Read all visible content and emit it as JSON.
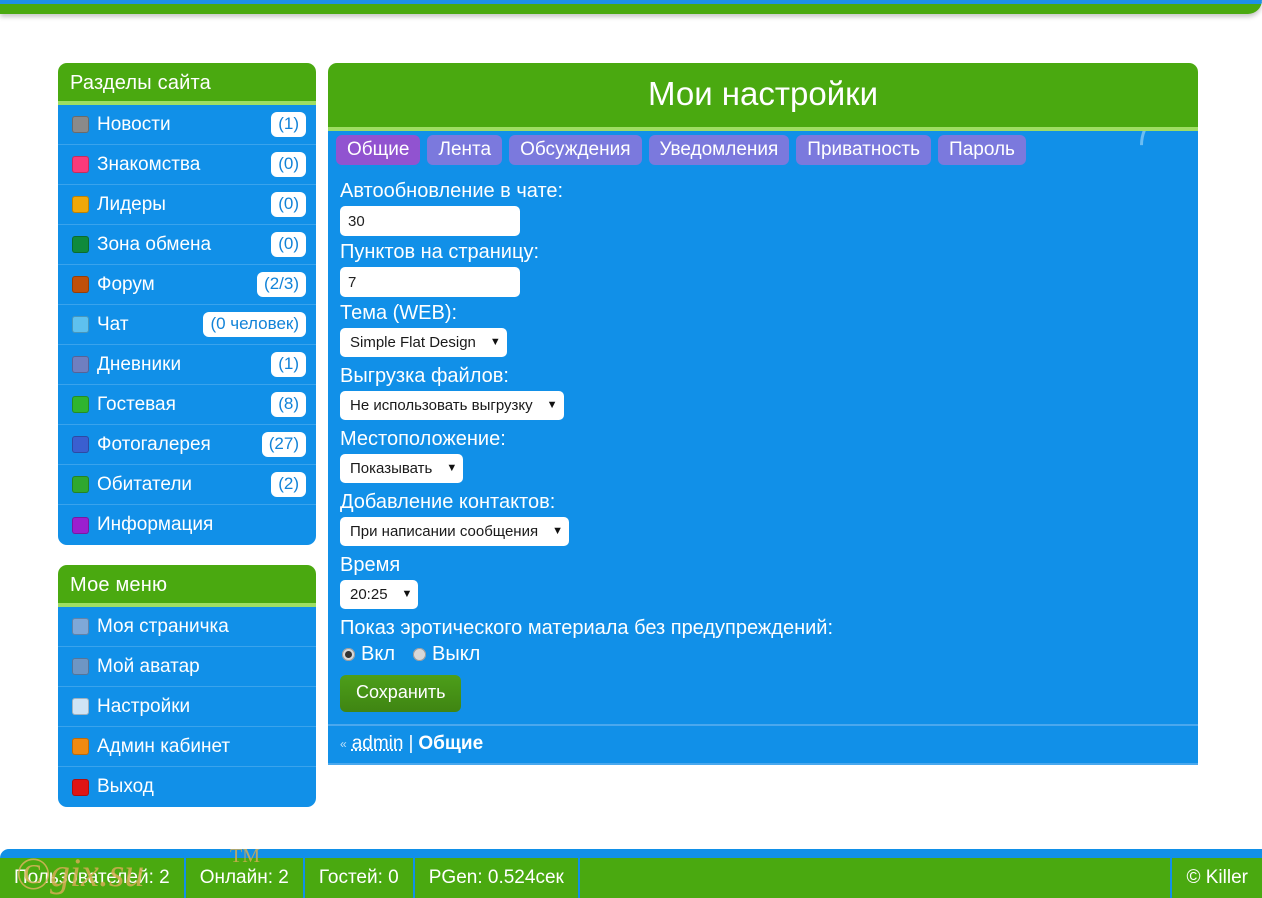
{
  "sidebar": {
    "sections": [
      {
        "title": "Разделы сайта",
        "items": [
          {
            "label": "Новости",
            "badge": "(1)",
            "icon": "news-icon",
            "color": "#8a8a8a"
          },
          {
            "label": "Знакомства",
            "badge": "(0)",
            "icon": "heart-icon",
            "color": "#fa3a7a"
          },
          {
            "label": "Лидеры",
            "badge": "(0)",
            "icon": "trophy-icon",
            "color": "#f0a808"
          },
          {
            "label": "Зона обмена",
            "badge": "(0)",
            "icon": "exchange-icon",
            "color": "#0f8a3c"
          },
          {
            "label": "Форум",
            "badge": "(2/3)",
            "icon": "forum-icon",
            "color": "#c0500a"
          },
          {
            "label": "Чат",
            "badge": "(0 человек)",
            "icon": "chat-icon",
            "color": "#5ec1ef"
          },
          {
            "label": "Дневники",
            "badge": "(1)",
            "icon": "diary-icon",
            "color": "#6f7fc0"
          },
          {
            "label": "Гостевая",
            "badge": "(8)",
            "icon": "guestbook-icon",
            "color": "#2fb52f"
          },
          {
            "label": "Фотогалерея",
            "badge": "(27)",
            "icon": "photo-icon",
            "color": "#3a5fd0"
          },
          {
            "label": "Обитатели",
            "badge": "(2)",
            "icon": "users-icon",
            "color": "#2fa82f"
          },
          {
            "label": "Информация",
            "badge": "",
            "icon": "info-icon",
            "color": "#9b1fcf"
          }
        ]
      },
      {
        "title": "Мое меню",
        "items": [
          {
            "label": "Моя страничка",
            "badge": "",
            "icon": "profile-card-icon",
            "color": "#7fa8d8"
          },
          {
            "label": "Мой аватар",
            "badge": "",
            "icon": "avatar-icon",
            "color": "#6e96c4"
          },
          {
            "label": "Настройки",
            "badge": "",
            "icon": "gear-icon",
            "color": "#cfe4f5"
          },
          {
            "label": "Админ кабинет",
            "badge": "",
            "icon": "admin-icon",
            "color": "#f08a10"
          },
          {
            "label": "Выход",
            "badge": "",
            "icon": "power-icon",
            "color": "#e01414"
          }
        ]
      }
    ]
  },
  "main": {
    "title": "Мои настройки",
    "tabs": [
      {
        "label": "Общие",
        "active": true
      },
      {
        "label": "Лента",
        "active": false
      },
      {
        "label": "Обсуждения",
        "active": false
      },
      {
        "label": "Уведомления",
        "active": false
      },
      {
        "label": "Приватность",
        "active": false
      },
      {
        "label": "Пароль",
        "active": false
      }
    ],
    "fields": {
      "chat_refresh_label": "Автообновление в чате:",
      "chat_refresh_value": "30",
      "items_per_page_label": "Пунктов на страницу:",
      "items_per_page_value": "7",
      "theme_label": "Тема (WEB):",
      "theme_value": "Simple Flat Design",
      "upload_label": "Выгрузка файлов:",
      "upload_value": "Не использовать выгрузку",
      "location_label": "Местоположение:",
      "location_value": "Показывать",
      "contacts_label": "Добавление контактов:",
      "contacts_value": "При написании сообщения",
      "time_label": "Время",
      "time_value": "20:25",
      "erotic_label": "Показ эротического материала без предупреждений:",
      "radio_on_label": "Вкл",
      "radio_off_label": "Выкл",
      "radio_selected": "on",
      "save_label": "Сохранить"
    },
    "breadcrumb": {
      "chevron": "«",
      "user": "admin",
      "separator": "|",
      "current": "Общие"
    }
  },
  "footer": {
    "cells": [
      "Пользователей: 2",
      "Онлайн: 2",
      "Гостей: 0",
      "PGen: 0.524сек"
    ],
    "right": "© Killer"
  },
  "watermark": {
    "copyright": "©",
    "text": "gix.su",
    "tm": "TM"
  },
  "colors": {
    "green": "#4aa910",
    "light_green": "#9ede63",
    "blue": "#1190e8",
    "tab_purple": "#7b79dd",
    "tab_active_purple": "#9153d0"
  }
}
